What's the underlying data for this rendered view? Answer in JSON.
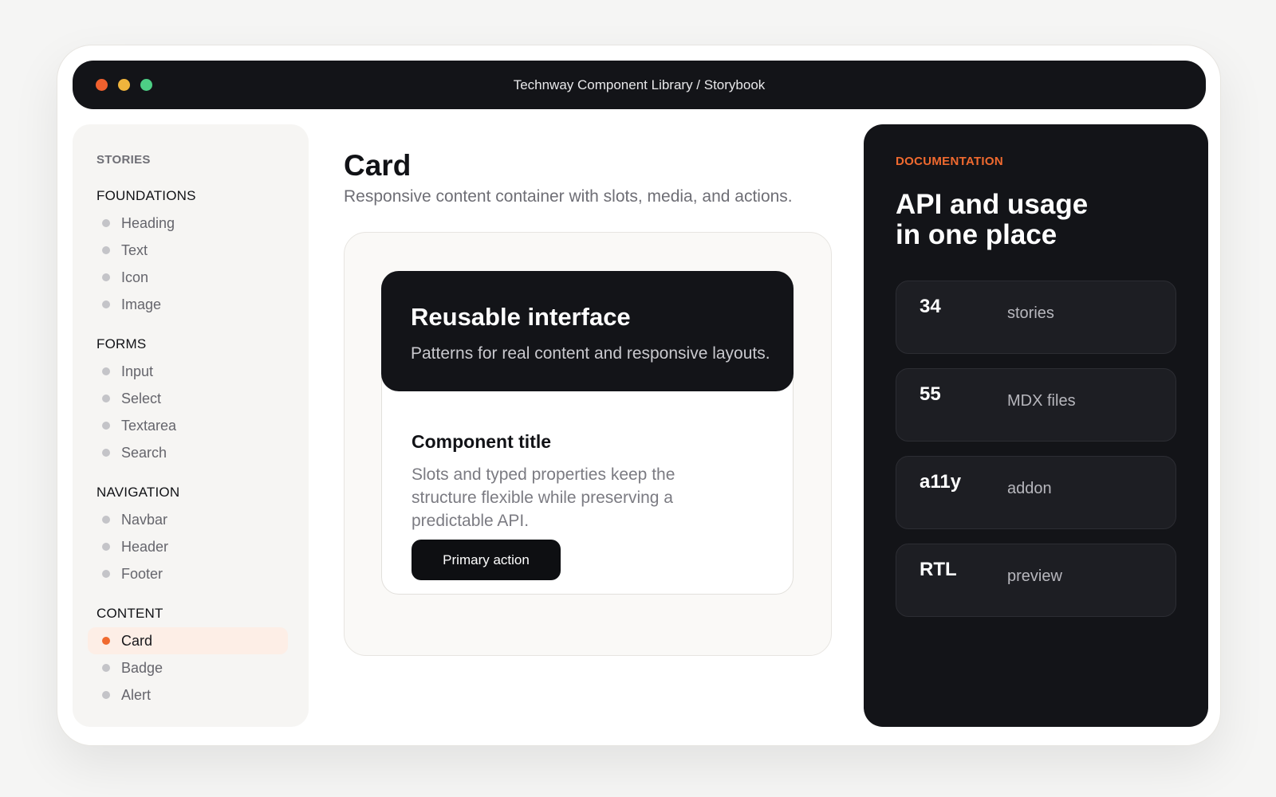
{
  "window": {
    "title": "Technway Component Library / Storybook"
  },
  "sidebar": {
    "heading": "STORIES",
    "groups": [
      {
        "title": "FOUNDATIONS",
        "items": [
          {
            "label": "Heading",
            "active": false
          },
          {
            "label": "Text",
            "active": false
          },
          {
            "label": "Icon",
            "active": false
          },
          {
            "label": "Image",
            "active": false
          }
        ]
      },
      {
        "title": "FORMS",
        "items": [
          {
            "label": "Input",
            "active": false
          },
          {
            "label": "Select",
            "active": false
          },
          {
            "label": "Textarea",
            "active": false
          },
          {
            "label": "Search",
            "active": false
          }
        ]
      },
      {
        "title": "NAVIGATION",
        "items": [
          {
            "label": "Navbar",
            "active": false
          },
          {
            "label": "Header",
            "active": false
          },
          {
            "label": "Footer",
            "active": false
          }
        ]
      },
      {
        "title": "CONTENT",
        "items": [
          {
            "label": "Card",
            "active": true
          },
          {
            "label": "Badge",
            "active": false
          },
          {
            "label": "Alert",
            "active": false
          }
        ]
      }
    ]
  },
  "main": {
    "title": "Card",
    "subtitle": "Responsive content container with slots, media, and actions.",
    "card": {
      "media_title": "Reusable interface",
      "media_text": "Patterns for real content and responsive layouts.",
      "title": "Component title",
      "text": "Slots and typed properties keep the structure flexible while preserving a predictable API.",
      "button_label": "Primary action"
    }
  },
  "docs": {
    "eyebrow": "DOCUMENTATION",
    "title_line1": "API and usage",
    "title_line2": "in one place",
    "stats": [
      {
        "value": "34",
        "label": "stories"
      },
      {
        "value": "55",
        "label": "MDX files"
      },
      {
        "value": "a11y",
        "label": "addon"
      },
      {
        "value": "RTL",
        "label": "preview"
      }
    ]
  },
  "colors": {
    "accent": "#f06a2f",
    "dark": "#131418",
    "traffic_red": "#f0602e",
    "traffic_yellow": "#f0b43c",
    "traffic_green": "#4dcf85"
  }
}
